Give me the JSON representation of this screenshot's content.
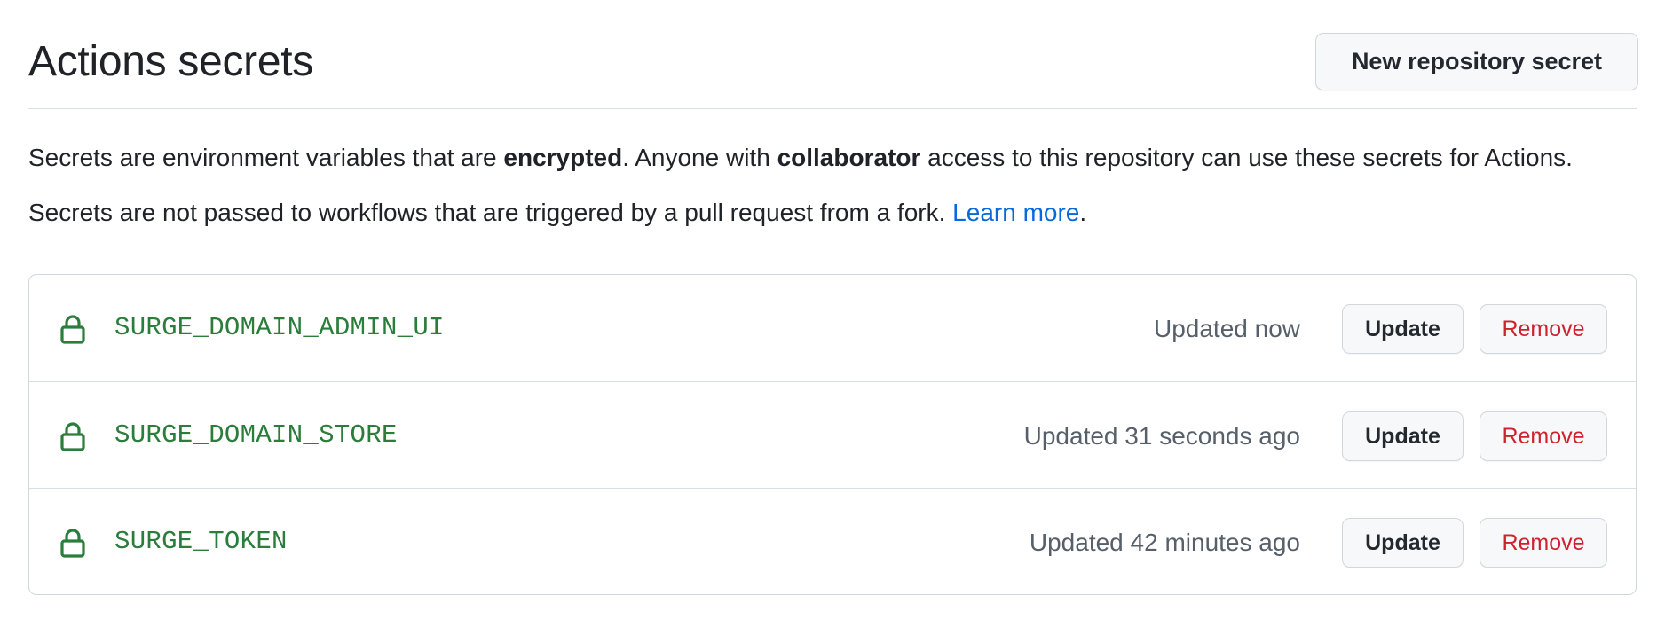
{
  "header": {
    "title": "Actions secrets",
    "new_secret_label": "New repository secret"
  },
  "description": {
    "line1": {
      "part1": "Secrets are environment variables that are ",
      "bold1": "encrypted",
      "part2": ". Anyone with ",
      "bold2": "collaborator",
      "part3": " access to this repository can use these secrets for Actions."
    },
    "line2": {
      "part1": "Secrets are not passed to workflows that are triggered by a pull request from a fork. ",
      "link": "Learn more",
      "part2": "."
    }
  },
  "secrets": [
    {
      "name": "SURGE_DOMAIN_ADMIN_UI",
      "updated": "Updated now",
      "update_label": "Update",
      "remove_label": "Remove",
      "icon": "lock-icon"
    },
    {
      "name": "SURGE_DOMAIN_STORE",
      "updated": "Updated 31 seconds ago",
      "update_label": "Update",
      "remove_label": "Remove",
      "icon": "lock-icon"
    },
    {
      "name": "SURGE_TOKEN",
      "updated": "Updated 42 minutes ago",
      "update_label": "Update",
      "remove_label": "Remove",
      "icon": "lock-icon"
    }
  ],
  "colors": {
    "secret_name": "#2a7d3a",
    "link": "#0969da",
    "remove": "#cf222e",
    "muted": "#57606a"
  }
}
